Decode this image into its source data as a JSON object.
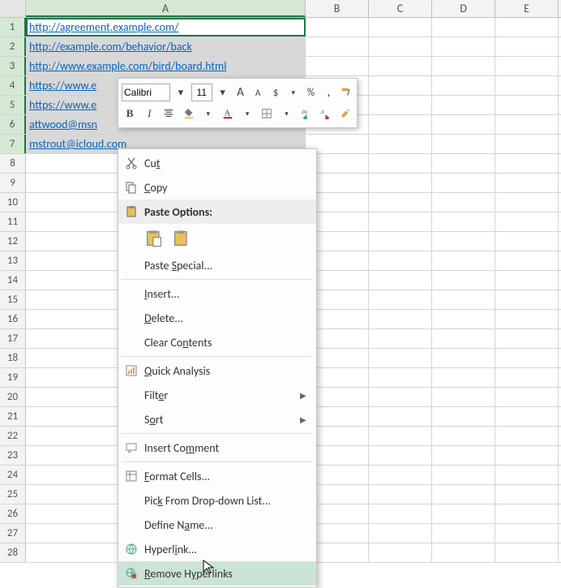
{
  "columns": [
    "A",
    "B",
    "C",
    "D",
    "E"
  ],
  "row_count": 28,
  "selected_rows": [
    1,
    2,
    3,
    4,
    5,
    6,
    7
  ],
  "cells": {
    "A1": "http://agreement.example.com/",
    "A2": "http://example.com/behavior/back",
    "A3": "http://www.example.com/bird/board.html",
    "A4": "https://www.e",
    "A5": "https://www.e",
    "A6": "attwood@msn",
    "A7": "mstrout@icloud.com"
  },
  "mini_toolbar": {
    "font_name": "Calibri",
    "font_size": "11",
    "buttons_row1": {
      "inc_font": "A",
      "dec_font": "A",
      "accounting": "$",
      "percent": "%",
      "comma": ","
    },
    "buttons_row2": {
      "bold": "B",
      "italic": "I"
    }
  },
  "context_menu": {
    "cut": "Cut",
    "copy": "Copy",
    "paste_options": "Paste Options:",
    "paste_special": "Paste Special...",
    "insert": "Insert...",
    "delete": "Delete...",
    "clear_contents": "Clear Contents",
    "quick_analysis": "Quick Analysis",
    "filter": "Filter",
    "sort": "Sort",
    "insert_comment": "Insert Comment",
    "format_cells": "Format Cells...",
    "pick_from_list": "Pick From Drop-down List...",
    "define_name": "Define Name...",
    "hyperlink": "Hyperlink...",
    "remove_hyperlinks": "Remove Hyperlinks"
  }
}
